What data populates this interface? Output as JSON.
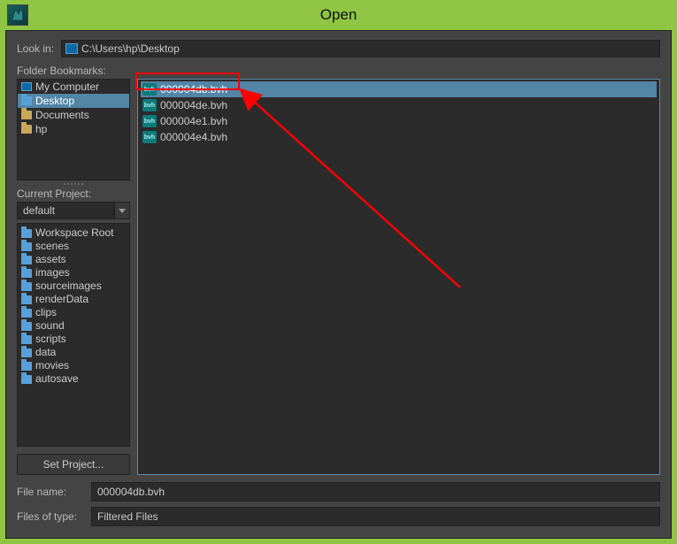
{
  "window": {
    "title": "Open"
  },
  "lookin": {
    "label": "Look in:",
    "path": "C:\\Users\\hp\\Desktop"
  },
  "bookmarks": {
    "label": "Folder Bookmarks:",
    "items": [
      {
        "label": "My Computer",
        "icon": "computer",
        "selected": false
      },
      {
        "label": "Desktop",
        "icon": "folder-blue",
        "selected": true
      },
      {
        "label": "Documents",
        "icon": "folder",
        "selected": false
      },
      {
        "label": "hp",
        "icon": "folder",
        "selected": false
      }
    ]
  },
  "project": {
    "label": "Current Project:",
    "value": "default"
  },
  "workspace": {
    "items": [
      "Workspace Root",
      "scenes",
      "assets",
      "images",
      "sourceimages",
      "renderData",
      "clips",
      "sound",
      "scripts",
      "data",
      "movies",
      "autosave"
    ]
  },
  "setProject": {
    "label": "Set Project..."
  },
  "files": {
    "items": [
      {
        "name": "000004db.bvh",
        "selected": true
      },
      {
        "name": "000004de.bvh",
        "selected": false
      },
      {
        "name": "000004e1.bvh",
        "selected": false
      },
      {
        "name": "000004e4.bvh",
        "selected": false
      }
    ]
  },
  "filename": {
    "label": "File name:",
    "value": "000004db.bvh"
  },
  "filetype": {
    "label": "Files of type:",
    "value": "Filtered Files"
  },
  "icons": {
    "bvh": "bvh"
  }
}
